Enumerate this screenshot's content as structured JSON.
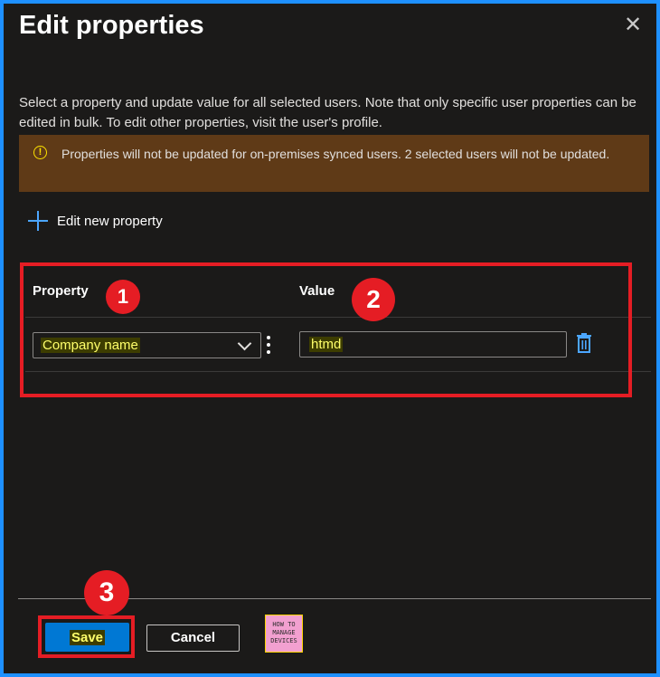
{
  "panel": {
    "title": "Edit properties",
    "close_glyph": "✕",
    "description": "Select a property and update value for all selected users. Note that only specific user properties can be edited in bulk. To edit other properties, visit the user's profile.",
    "warning": {
      "icon": "info-icon",
      "glyph": "!",
      "text": "Properties will not be updated for on-premises synced users. 2 selected users will not be updated."
    },
    "add_property_label": "Edit new property"
  },
  "table": {
    "columns": [
      "Property",
      "Value"
    ],
    "rows": [
      {
        "property": "Company name",
        "value": "htmd"
      }
    ]
  },
  "annotations": {
    "badges": [
      "1",
      "2",
      "3"
    ],
    "highlight_color": "#e51d24"
  },
  "footer": {
    "save_label": "Save",
    "cancel_label": "Cancel",
    "logo_lines": [
      "HOW TO",
      "MANAGE",
      "DEVICES"
    ]
  },
  "colors": {
    "accent": "#0078d4",
    "frame": "#1e90ff",
    "warning_bg": "#5f3a17",
    "background": "#1b1a19"
  }
}
